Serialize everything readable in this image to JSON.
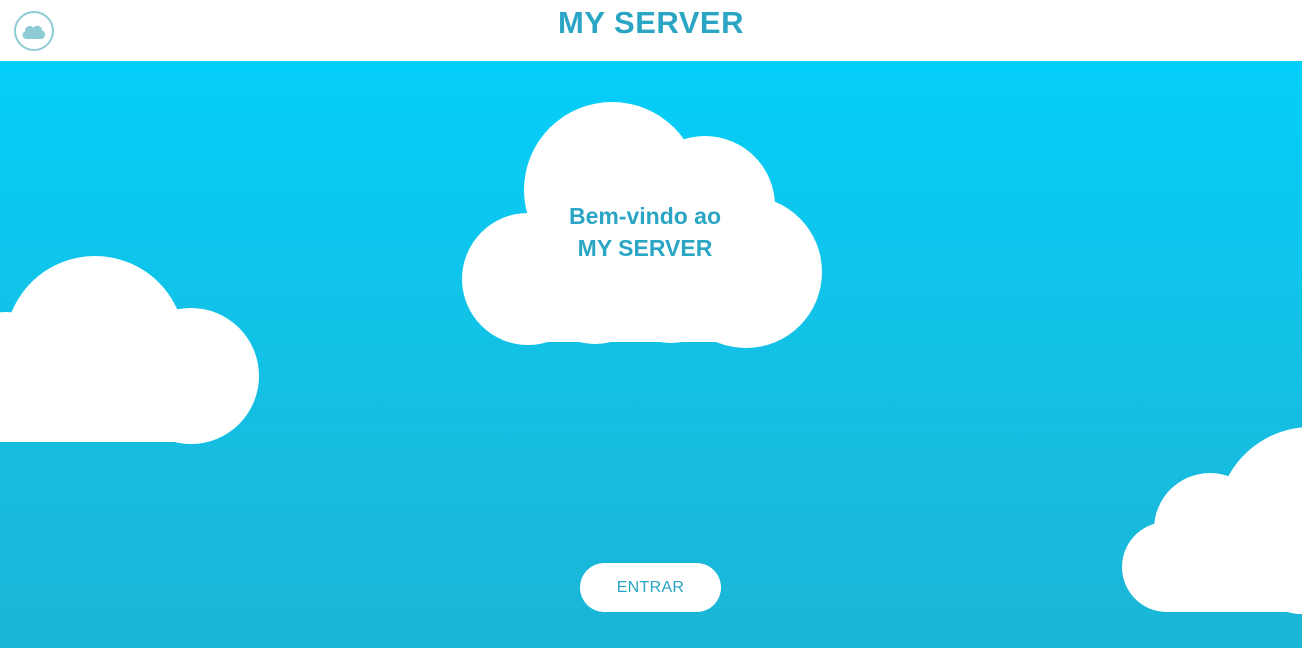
{
  "header": {
    "title": "MY SERVER",
    "logo_icon": "cloud-icon"
  },
  "welcome": {
    "line1": "Bem-vindo ao",
    "line2": "MY SERVER"
  },
  "enter_button": {
    "label": "ENTRAR"
  },
  "colors": {
    "accent": "#2aa6c4",
    "sky_top": "#04cffa",
    "sky_bottom": "#1bb5d6",
    "cloud": "#ffffff",
    "logo_ring": "#8fcbd5"
  }
}
